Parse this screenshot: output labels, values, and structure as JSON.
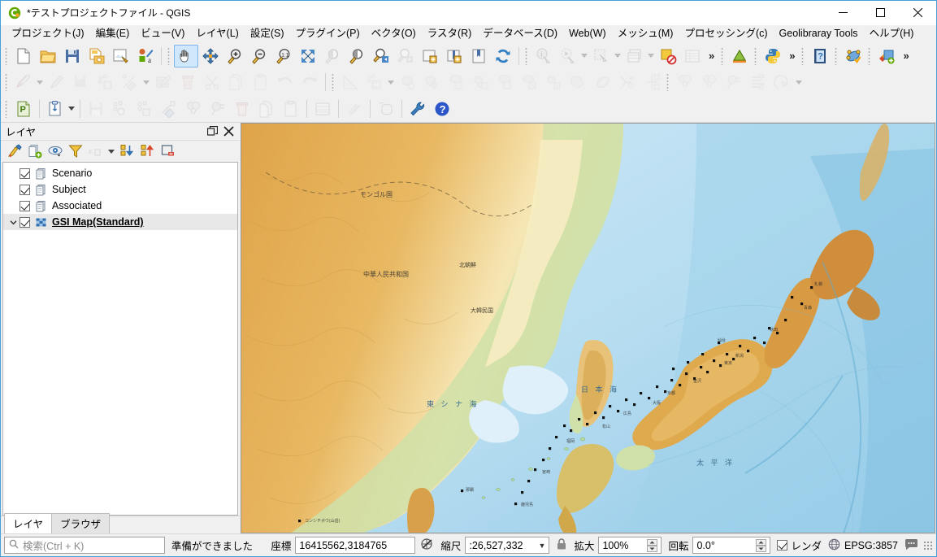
{
  "window": {
    "title": "*テストプロジェクトファイル - QGIS",
    "logo_icon": "qgis-logo-icon",
    "minimize_label": "minimize-icon",
    "maximize_label": "maximize-icon",
    "close_label": "close-icon"
  },
  "menubar": {
    "items": [
      {
        "label": "プロジェクト(J)",
        "name": "menu-project"
      },
      {
        "label": "編集(E)",
        "name": "menu-edit"
      },
      {
        "label": "ビュー(V)",
        "name": "menu-view"
      },
      {
        "label": "レイヤ(L)",
        "name": "menu-layer"
      },
      {
        "label": "設定(S)",
        "name": "menu-settings"
      },
      {
        "label": "プラグイン(P)",
        "name": "menu-plugins"
      },
      {
        "label": "ベクタ(O)",
        "name": "menu-vector"
      },
      {
        "label": "ラスタ(R)",
        "name": "menu-raster"
      },
      {
        "label": "データベース(D)",
        "name": "menu-database"
      },
      {
        "label": "Web(W)",
        "name": "menu-web"
      },
      {
        "label": "メッシュ(M)",
        "name": "menu-mesh"
      },
      {
        "label": "プロセッシング(c)",
        "name": "menu-processing"
      },
      {
        "label": "Geolibraray Tools",
        "name": "menu-geolibrary-tools"
      },
      {
        "label": "ヘルプ(H)",
        "name": "menu-help"
      }
    ]
  },
  "toolbar": {
    "row1": {
      "overflow_label": "»",
      "icons": [
        "new-project-icon",
        "open-project-icon",
        "save-project-icon",
        "save-project-as-icon",
        "new-print-layout-icon",
        "style-manager-icon",
        "pan-map-icon",
        "pan-to-selection-icon",
        "zoom-in-icon",
        "zoom-out-icon",
        "zoom-native-icon",
        "zoom-full-icon",
        "zoom-to-selection-icon",
        "zoom-to-layer-icon",
        "zoom-last-icon",
        "zoom-next-icon",
        "new-map-view-icon",
        "new-3d-map-view-icon",
        "new-bookmark-icon",
        "refresh-icon",
        "identify-features-icon",
        "run-feature-action-icon",
        "select-features-icon",
        "deselect-features-icon",
        "open-attribute-table-icon",
        "clear-selection-icon",
        "measure-icon",
        "python-console-icon",
        "help-contents-icon",
        "topology-checker-icon",
        "add-layer-icon"
      ]
    },
    "row2": {
      "icons": [
        "toggle-editing-icon",
        "current-edits-icon",
        "save-layer-edits-icon",
        "add-feature-icon",
        "vertex-tool-icon",
        "modify-attributes-icon",
        "delete-selected-icon",
        "cut-features-icon",
        "copy-features-icon",
        "paste-features-icon",
        "undo-icon",
        "redo-icon",
        "measure-line-icon",
        "move-feature-icon",
        "rotate-feature-icon",
        "simplify-feature-icon",
        "add-ring-icon",
        "add-part-icon",
        "fill-ring-icon",
        "delete-ring-icon",
        "delete-part-icon",
        "reshape-features-icon",
        "offset-curve-icon",
        "split-features-icon",
        "split-parts-icon",
        "merge-features-icon",
        "merge-attributes-icon",
        "rotate-point-symbols-icon",
        "offset-point-symbols-icon"
      ]
    },
    "row3": {
      "icons": [
        "project-properties-icon",
        "clipboard-icon",
        "save-icon",
        "add-nodes-icon",
        "add-polygon-icon",
        "select-node-icon",
        "cut-network-icon",
        "merge-network-icon",
        "delete-network-icon",
        "copy-network-icon",
        "paste-network-icon",
        "table-view-icon",
        "hatch-icon",
        "database-icon",
        "settings-wrench-icon",
        "help-icon"
      ]
    }
  },
  "layers_panel": {
    "title": "レイヤ",
    "undock_icon": "undock-icon",
    "close_icon": "close-panel-icon",
    "toolbar_icons": [
      "open-layer-styling-icon",
      "add-group-icon",
      "manage-visibility-icon",
      "filter-legend-icon",
      "filter-legend-expression-icon",
      "expand-all-icon",
      "collapse-all-icon",
      "remove-layer-icon"
    ],
    "layers": [
      {
        "name": "Scenario",
        "checked": true,
        "icon": "vector-layer-icon",
        "selected": false,
        "expandable": false,
        "bold": false
      },
      {
        "name": "Subject",
        "checked": true,
        "icon": "vector-layer-icon",
        "selected": false,
        "expandable": false,
        "bold": false
      },
      {
        "name": "Associated",
        "checked": true,
        "icon": "vector-layer-icon",
        "selected": false,
        "expandable": false,
        "bold": false
      },
      {
        "name": "GSI Map(Standard)",
        "checked": true,
        "icon": "raster-layer-icon",
        "selected": true,
        "expandable": true,
        "bold": true
      }
    ],
    "tabs": [
      {
        "label": "レイヤ",
        "active": true,
        "name": "tab-layers"
      },
      {
        "label": "ブラウザ",
        "active": false,
        "name": "tab-browser"
      }
    ]
  },
  "map": {
    "alt": "GSI relief basemap of East Asia centered on Japan with point markers at prefectural capitals",
    "labels": {
      "mongolia": "モンゴル国",
      "china": "中華人民共和国",
      "north_korea": "北朝鮮",
      "south_korea": "大韓民国",
      "japan_sea": "日 本 海",
      "east_china_sea": "東 シ ナ 海",
      "pacific": "太 平 洋"
    },
    "water_color": "#bfe3f5",
    "lowland_color": "#d7e8b8",
    "highland_color": "#e0a94e",
    "deep_ocean_color": "#9fd0ea"
  },
  "statusbar": {
    "search_placeholder": "検索(Ctrl + K)",
    "search_icon": "search-icon",
    "search_value": "",
    "message": "準備ができました",
    "coordinate_label": "座標",
    "coordinate_value": "16415562,3184765",
    "coordinate_toggle_icon": "toggle-extents-icon",
    "scale_label": "縮尺",
    "scale_value": ":26,527,332",
    "scale_lock_icon": "lock-icon",
    "magnifier_label": "拡大",
    "magnifier_value": "100%",
    "rotation_label": "回転",
    "rotation_value": "0.0°",
    "render_label": "レンダ",
    "render_checked": true,
    "crs_icon": "crs-globe-icon",
    "crs_value": "EPSG:3857",
    "messages_icon": "messages-log-icon"
  }
}
